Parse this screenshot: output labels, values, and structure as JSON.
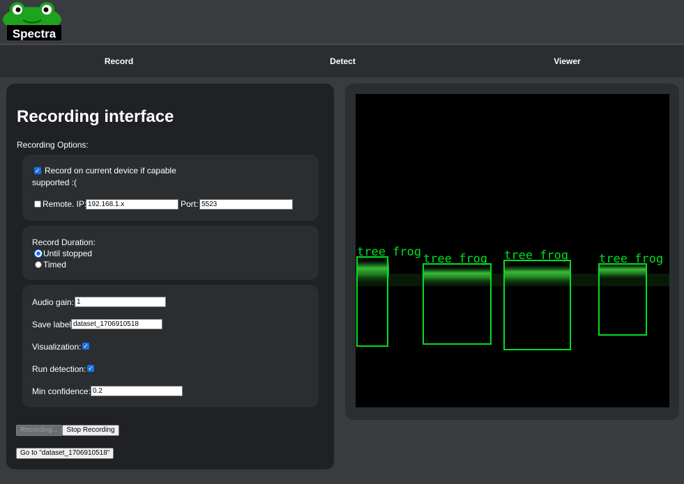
{
  "app": {
    "logo_text": "Spectra"
  },
  "nav": {
    "record": "Record",
    "detect": "Detect",
    "viewer": "Viewer"
  },
  "recording": {
    "title": "Recording interface",
    "options_label": "Recording Options:",
    "device": {
      "checkbox_label": "Record on current device if capable",
      "checked": true,
      "status_text": "supported :("
    },
    "remote": {
      "label": "Remote. IP:",
      "checked": false,
      "ip_value": "192.168.1.x",
      "port_label": "Port:",
      "port_value": "5523"
    },
    "duration": {
      "label": "Record Duration:",
      "until_stopped": "Until stopped",
      "timed": "Timed",
      "selected": "Until stopped"
    },
    "settings": {
      "audio_gain_label": "Audio gain:",
      "audio_gain_value": "1",
      "save_label_label": "Save label:",
      "save_label_value": "dataset_1706910518",
      "visualization_label": "Visualization:",
      "visualization_checked": true,
      "run_detection_label": "Run detection:",
      "run_detection_checked": true,
      "min_confidence_label": "Min confidence:",
      "min_confidence_value": "0.2"
    },
    "buttons": {
      "recording": "Recording...",
      "stop": "Stop Recording",
      "goto": "Go to \"dataset_1706910518\""
    }
  },
  "viewer": {
    "box_color": "#00e020",
    "detections": [
      {
        "label": "tree frog"
      },
      {
        "label": "tree frog"
      },
      {
        "label": "tree frog"
      },
      {
        "label": "tree frog"
      }
    ]
  }
}
